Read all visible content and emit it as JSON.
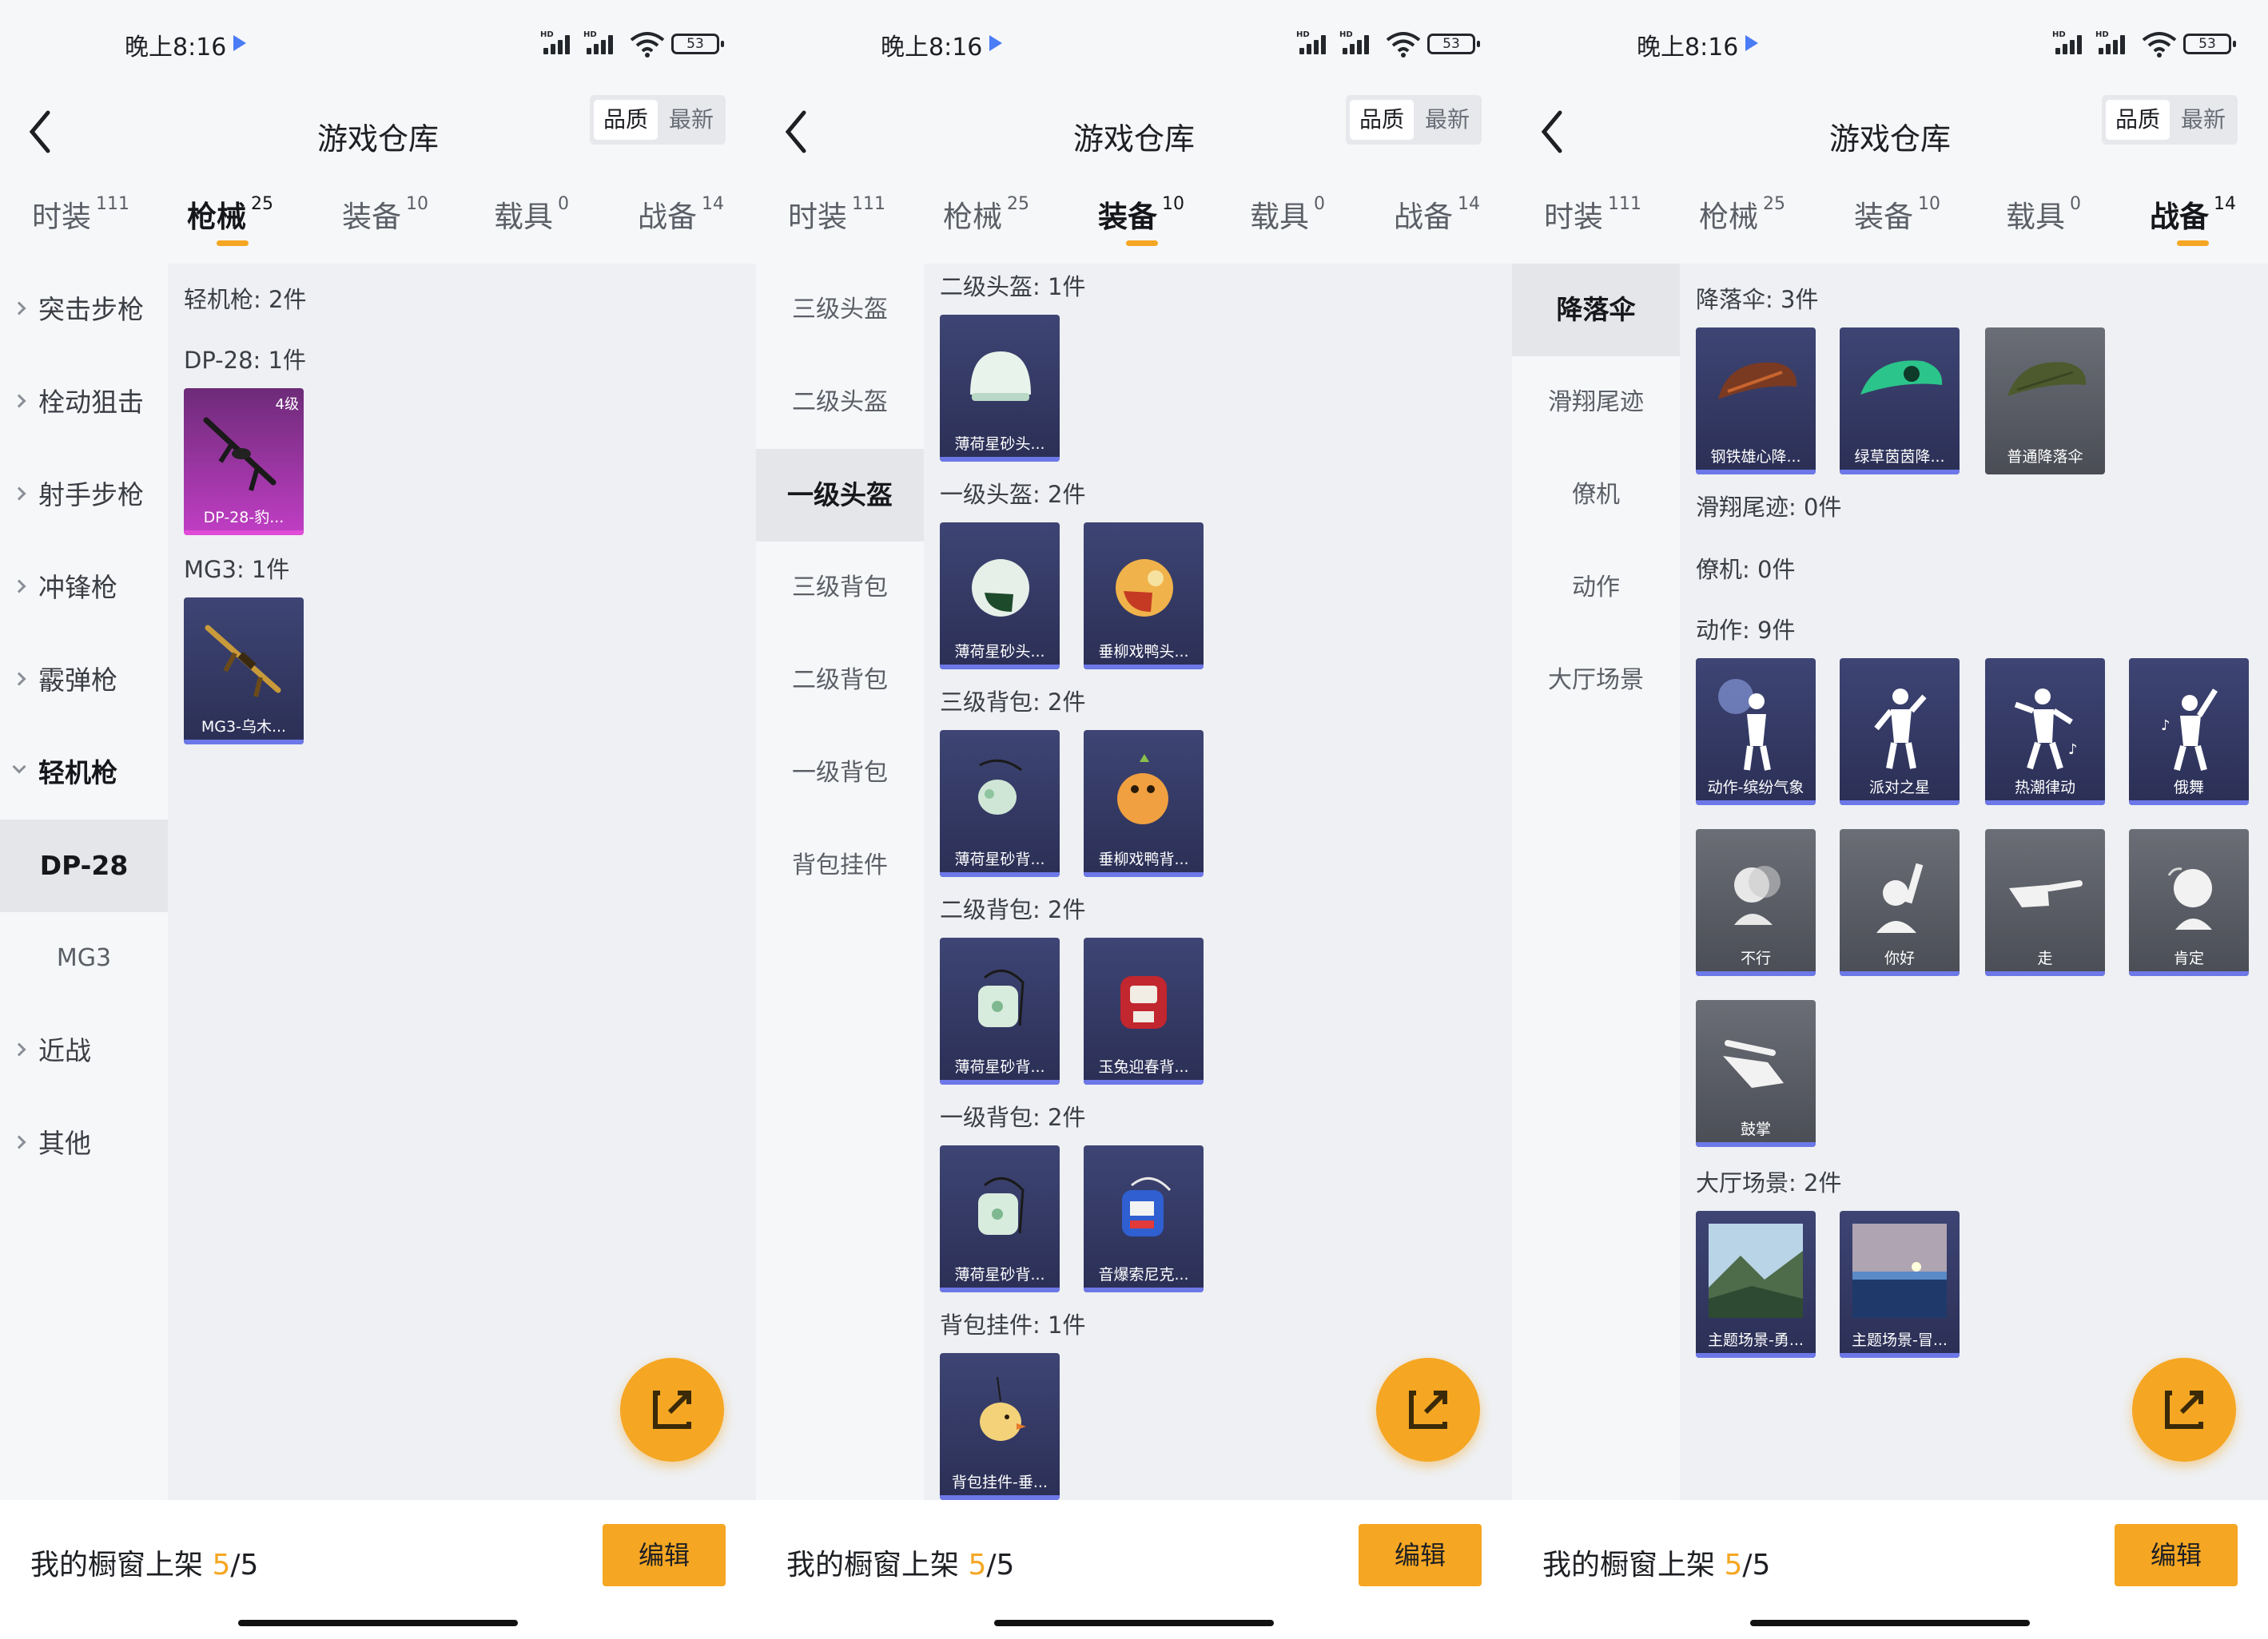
{
  "status": {
    "time": "晚上8:16",
    "battery": "53"
  },
  "header": {
    "title": "游戏仓库",
    "sort_quality": "品质",
    "sort_latest": "最新"
  },
  "tabs": [
    {
      "label": "时装",
      "count": "111"
    },
    {
      "label": "枪械",
      "count": "25"
    },
    {
      "label": "装备",
      "count": "10"
    },
    {
      "label": "载具",
      "count": "0"
    },
    {
      "label": "战备",
      "count": "14"
    }
  ],
  "bottom": {
    "prefix": "我的橱窗上架 ",
    "current": "5",
    "total": "/5",
    "edit_label": "编辑"
  },
  "colors": {
    "accent": "#f5a623",
    "card_bg": "#2f345c",
    "rare_pink": "#c13ec5"
  },
  "panel1": {
    "sidebar": [
      "突击步枪",
      "栓动狙击",
      "射手步枪",
      "冲锋枪",
      "霰弹枪",
      "轻机枪",
      "DP-28",
      "MG3",
      "近战",
      "其他"
    ],
    "sections": [
      {
        "label": "轻机枪: 2件"
      },
      {
        "label": "DP-28: 1件",
        "items": [
          {
            "name": "DP-28-豹...",
            "level": "4级"
          }
        ]
      },
      {
        "label": "MG3: 1件",
        "items": [
          {
            "name": "MG3-乌木..."
          }
        ]
      }
    ]
  },
  "panel2": {
    "sidebar": [
      "三级头盔",
      "二级头盔",
      "一级头盔",
      "三级背包",
      "二级背包",
      "一级背包",
      "背包挂件"
    ],
    "sections": [
      {
        "label": "二级头盔: 1件",
        "items": [
          {
            "name": "薄荷星砂头..."
          }
        ]
      },
      {
        "label": "一级头盔: 2件",
        "items": [
          {
            "name": "薄荷星砂头..."
          },
          {
            "name": "垂柳戏鸭头..."
          }
        ]
      },
      {
        "label": "三级背包: 2件",
        "items": [
          {
            "name": "薄荷星砂背..."
          },
          {
            "name": "垂柳戏鸭背..."
          }
        ]
      },
      {
        "label": "二级背包: 2件",
        "items": [
          {
            "name": "薄荷星砂背..."
          },
          {
            "name": "玉兔迎春背..."
          }
        ]
      },
      {
        "label": "一级背包: 2件",
        "items": [
          {
            "name": "薄荷星砂背..."
          },
          {
            "name": "音爆索尼克..."
          }
        ]
      },
      {
        "label": "背包挂件: 1件",
        "items": [
          {
            "name": "背包挂件-垂..."
          }
        ]
      }
    ]
  },
  "panel3": {
    "sidebar": [
      "降落伞",
      "滑翔尾迹",
      "僚机",
      "动作",
      "大厅场景"
    ],
    "sections": [
      {
        "label": "降落伞: 3件",
        "items": [
          {
            "name": "钢铁雄心降..."
          },
          {
            "name": "绿草茵茵降..."
          },
          {
            "name": "普通降落伞"
          }
        ]
      },
      {
        "label": "滑翔尾迹: 0件"
      },
      {
        "label": "僚机: 0件"
      },
      {
        "label": "动作: 9件",
        "items": [
          {
            "name": "动作-缤纷气象"
          },
          {
            "name": "派对之星"
          },
          {
            "name": "热潮律动"
          },
          {
            "name": "俄舞"
          },
          {
            "name": "不行"
          },
          {
            "name": "你好"
          },
          {
            "name": "走"
          },
          {
            "name": "肯定"
          },
          {
            "name": "鼓掌"
          }
        ]
      },
      {
        "label": "大厅场景: 2件",
        "items": [
          {
            "name": "主题场景-勇..."
          },
          {
            "name": "主题场景-冒..."
          }
        ]
      }
    ]
  }
}
